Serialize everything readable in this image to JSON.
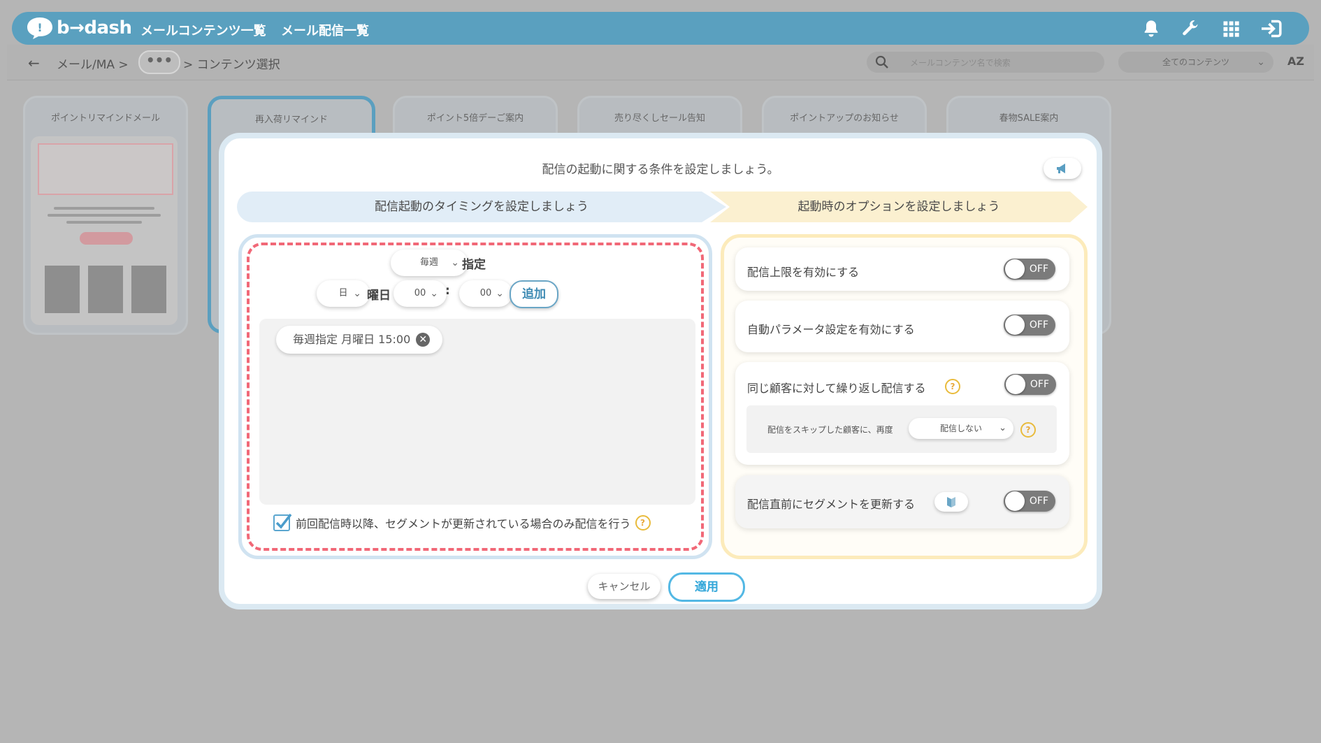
{
  "header": {
    "logo_text": "b→dash",
    "nav": [
      "メールコンテンツ一覧",
      "メール配信一覧"
    ],
    "icons": [
      "bell-icon",
      "wrench-icon",
      "grid-icon",
      "logout-icon"
    ]
  },
  "subbar": {
    "crumb1": "メール/MA >",
    "crumb_more": "•••",
    "crumb2": "> コンテンツ選択",
    "search_placeholder": "メールコンテンツ名で検索",
    "filter_value": "全てのコンテンツ",
    "sort_label": "AZ"
  },
  "cards": [
    {
      "title": "ポイントリマインドメール"
    },
    {
      "title": "再入荷リマインド"
    },
    {
      "title": "ポイント5倍デーご案内"
    },
    {
      "title": "売り尽くしセール告知"
    },
    {
      "title": "ポイントアップのお知らせ"
    },
    {
      "title": "春物SALE案内"
    }
  ],
  "modal": {
    "title": "配信の起動に関する条件を設定しましょう。",
    "step1": "配信起動のタイミングを設定しましょう",
    "step2": "起動時のオプションを設定しましょう",
    "timing": {
      "frequency": "毎週",
      "frequency_suffix": "指定",
      "weekday": "日",
      "weekday_suffix": "曜日",
      "hour": "00",
      "separator": ":",
      "minute": "00",
      "add_label": "追加",
      "schedules": [
        "毎週指定 月曜日 15:00"
      ],
      "checkbox_label": "前回配信時以降、セグメントが更新されている場合のみ配信を行う",
      "checkbox_checked": true
    },
    "options": [
      {
        "label": "配信上限を有効にする",
        "state": "OFF"
      },
      {
        "label": "自動パラメータ設定を有効にする",
        "state": "OFF"
      },
      {
        "label": "同じ顧客に対して繰り返し配信する",
        "state": "OFF",
        "sub_text": "配信をスキップした顧客に、再度",
        "sub_select": "配信しない"
      },
      {
        "label": "配信直前にセグメントを更新する",
        "state": "OFF"
      }
    ],
    "cancel_label": "キャンセル",
    "apply_label": "適用"
  },
  "colors": {
    "header_blue": "#5aa0bf",
    "dashed_red": "#f16877",
    "apply_blue": "#31a6d9",
    "step1_bg": "#e1edf7",
    "step2_bg": "#fbf0d0"
  }
}
